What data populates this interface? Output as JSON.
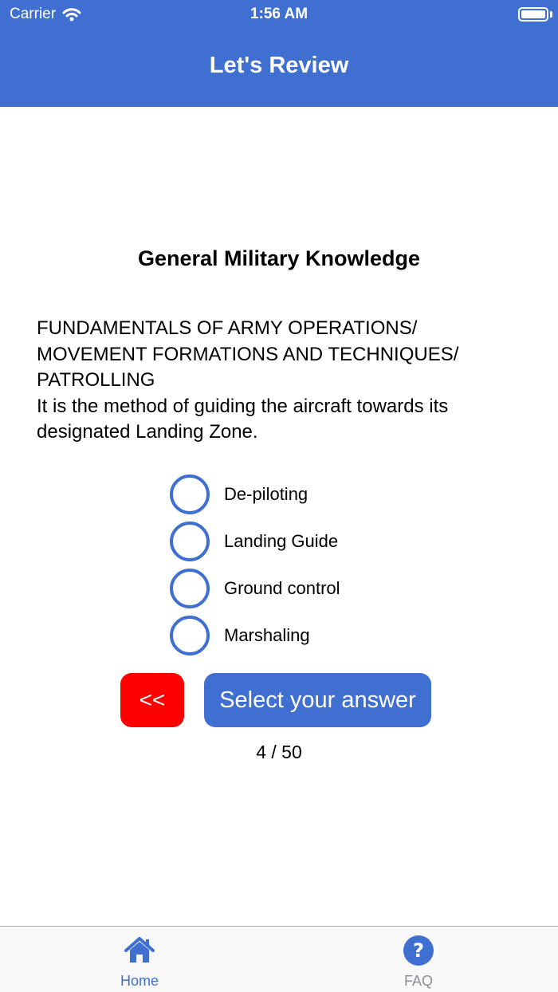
{
  "status_bar": {
    "carrier": "Carrier",
    "time": "1:56 AM"
  },
  "header": {
    "title": "Let's Review"
  },
  "quiz": {
    "category": "General Military Knowledge",
    "question_lines": [
      "FUNDAMENTALS OF ARMY OPERATIONS/",
      "MOVEMENT FORMATIONS AND TECHNIQUES/",
      "PATROLLING",
      "It is the method of guiding the aircraft towards its",
      "designated Landing Zone."
    ],
    "options": [
      "De-piloting",
      "Landing Guide",
      "Ground control",
      "Marshaling"
    ],
    "back_label": "<<",
    "submit_label": "Select your answer",
    "progress": "4 / 50"
  },
  "tabbar": {
    "home_label": "Home",
    "faq_label": "FAQ",
    "active_color": "#3f6fd0",
    "inactive_color": "#8e8e93"
  },
  "colors": {
    "primary": "#3f6fd0",
    "back_button": "#ff0000"
  }
}
